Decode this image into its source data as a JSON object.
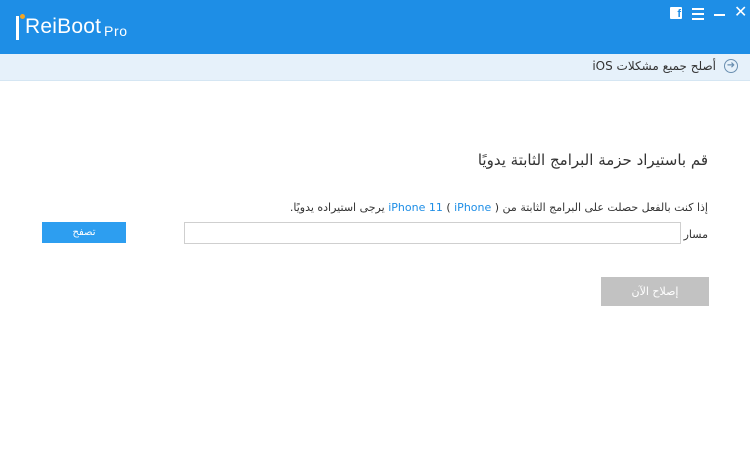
{
  "app": {
    "logo_letter": "R",
    "name": "eiBoot",
    "edition": "Pro"
  },
  "window_controls": {
    "facebook_glyph": "f"
  },
  "breadcrumb": {
    "text": "أصلح جميع مشكلات iOS"
  },
  "main": {
    "title": "قم باستيراد حزمة البرامج الثابتة يدويًا",
    "hint_pre": "إذا كنت بالفعل حصلت على البرامج الثابتة من ",
    "hint_model": "iPhone 11",
    "hint_paren_open": " ( ",
    "hint_device": "iPhone",
    "hint_post": " ) يرجى استيراده يدويًا.",
    "path_label": "مسار",
    "path_value": "",
    "browse_label": "تصفح",
    "fix_label": "إصلاح الآن"
  },
  "colors": {
    "titlebar": "#1e8ee6",
    "accent": "#2d9ef0",
    "disabled_button": "#c2c2c2"
  }
}
